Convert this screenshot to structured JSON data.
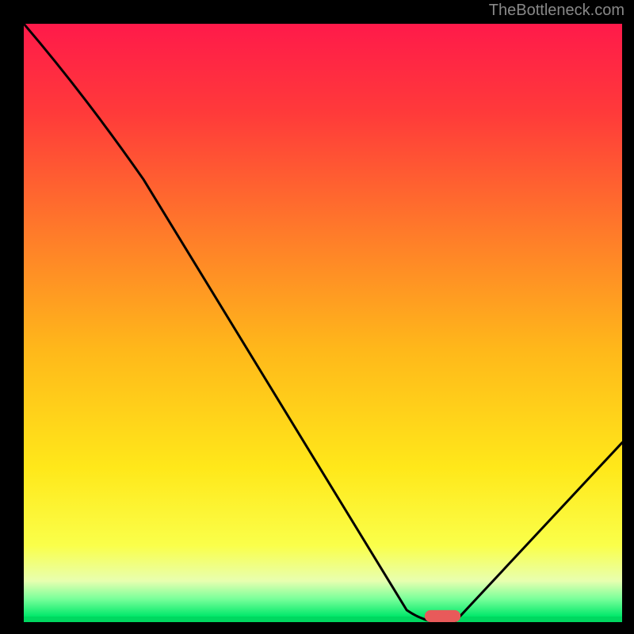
{
  "watermark": "TheBottleneck.com",
  "chart_data": {
    "type": "line",
    "title": "",
    "xlabel": "",
    "ylabel": "",
    "x_range": [
      0,
      100
    ],
    "y_range": [
      0,
      100
    ],
    "background_gradient": {
      "stops": [
        {
          "offset": 0,
          "color": "#ff1a4a"
        },
        {
          "offset": 15,
          "color": "#ff3a3a"
        },
        {
          "offset": 35,
          "color": "#ff7a2a"
        },
        {
          "offset": 55,
          "color": "#ffb81a"
        },
        {
          "offset": 75,
          "color": "#ffe81a"
        },
        {
          "offset": 88,
          "color": "#faff4a"
        },
        {
          "offset": 94,
          "color": "#e8ffb0"
        },
        {
          "offset": 97,
          "color": "#7aff9a"
        },
        {
          "offset": 100,
          "color": "#00e86a"
        }
      ]
    },
    "curve": [
      {
        "x": 0,
        "y": 100
      },
      {
        "x": 20,
        "y": 74
      },
      {
        "x": 64,
        "y": 2
      },
      {
        "x": 71,
        "y": 0
      },
      {
        "x": 72,
        "y": 0
      },
      {
        "x": 100,
        "y": 30
      }
    ],
    "marker": {
      "x": 70,
      "y": 1,
      "width": 6,
      "height": 2,
      "color": "#e85a5a"
    }
  }
}
